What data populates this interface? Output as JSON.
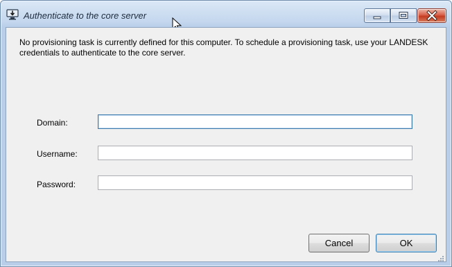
{
  "window": {
    "title": "Authenticate to the core server"
  },
  "intro": {
    "message": "No provisioning task is currently defined for this computer.  To schedule a provisioning task, use your LANDESK credentials to authenticate to the core server."
  },
  "form": {
    "domain": {
      "label": "Domain:",
      "value": ""
    },
    "username": {
      "label": "Username:",
      "value": ""
    },
    "password": {
      "label": "Password:",
      "value": ""
    }
  },
  "buttons": {
    "cancel": "Cancel",
    "ok": "OK"
  },
  "icons": {
    "app": "download-computer-icon",
    "minimize": "minimize-icon",
    "maximize": "maximize-icon",
    "close": "close-icon",
    "cursor": "mouse-cursor-icon"
  }
}
